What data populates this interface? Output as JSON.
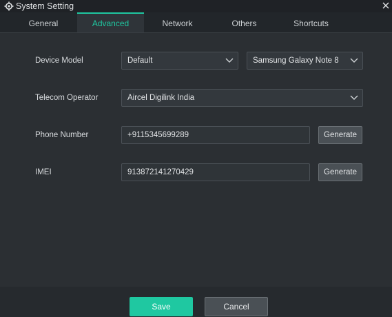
{
  "window": {
    "title": "System Setting",
    "icon": "gear-icon",
    "close_icon": "close-icon"
  },
  "tabs": [
    {
      "label": "General",
      "active": false
    },
    {
      "label": "Advanced",
      "active": true
    },
    {
      "label": "Network",
      "active": false
    },
    {
      "label": "Others",
      "active": false
    },
    {
      "label": "Shortcuts",
      "active": false
    }
  ],
  "form": {
    "device_model": {
      "label": "Device Model",
      "brand_value": "Default",
      "model_value": "Samsung Galaxy Note 8"
    },
    "telecom_operator": {
      "label": "Telecom Operator",
      "value": "Aircel Digilink India"
    },
    "phone_number": {
      "label": "Phone Number",
      "value": "+9115345699289",
      "button": "Generate"
    },
    "imei": {
      "label": "IMEI",
      "value": "913872141270429",
      "button": "Generate"
    }
  },
  "footer": {
    "save": "Save",
    "cancel": "Cancel"
  },
  "colors": {
    "accent": "#1fc8a1",
    "background": "#2b2f33"
  }
}
